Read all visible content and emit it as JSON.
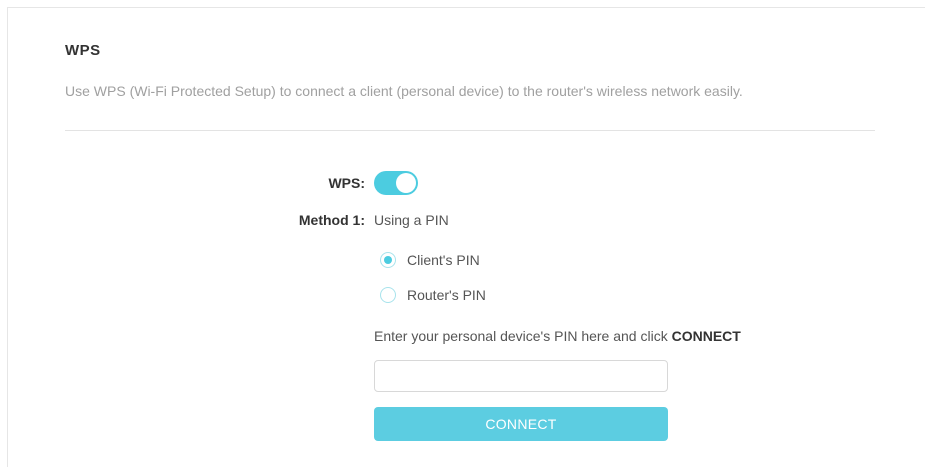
{
  "section": {
    "title": "WPS",
    "description": "Use WPS (Wi-Fi Protected Setup) to connect a client (personal device) to the router's wireless network easily."
  },
  "wps": {
    "label": "WPS:",
    "enabled": true
  },
  "method1": {
    "label": "Method 1:",
    "value": "Using a PIN",
    "options": [
      {
        "label": "Client's PIN",
        "selected": true
      },
      {
        "label": "Router's PIN",
        "selected": false
      }
    ],
    "instruction_prefix": "Enter your personal device's PIN here and click ",
    "instruction_bold": "CONNECT",
    "pin_value": "",
    "connect_label": "CONNECT"
  },
  "colors": {
    "accent": "#4ccce0",
    "button": "#5ccde1",
    "muted_text": "#a0a0a0"
  }
}
